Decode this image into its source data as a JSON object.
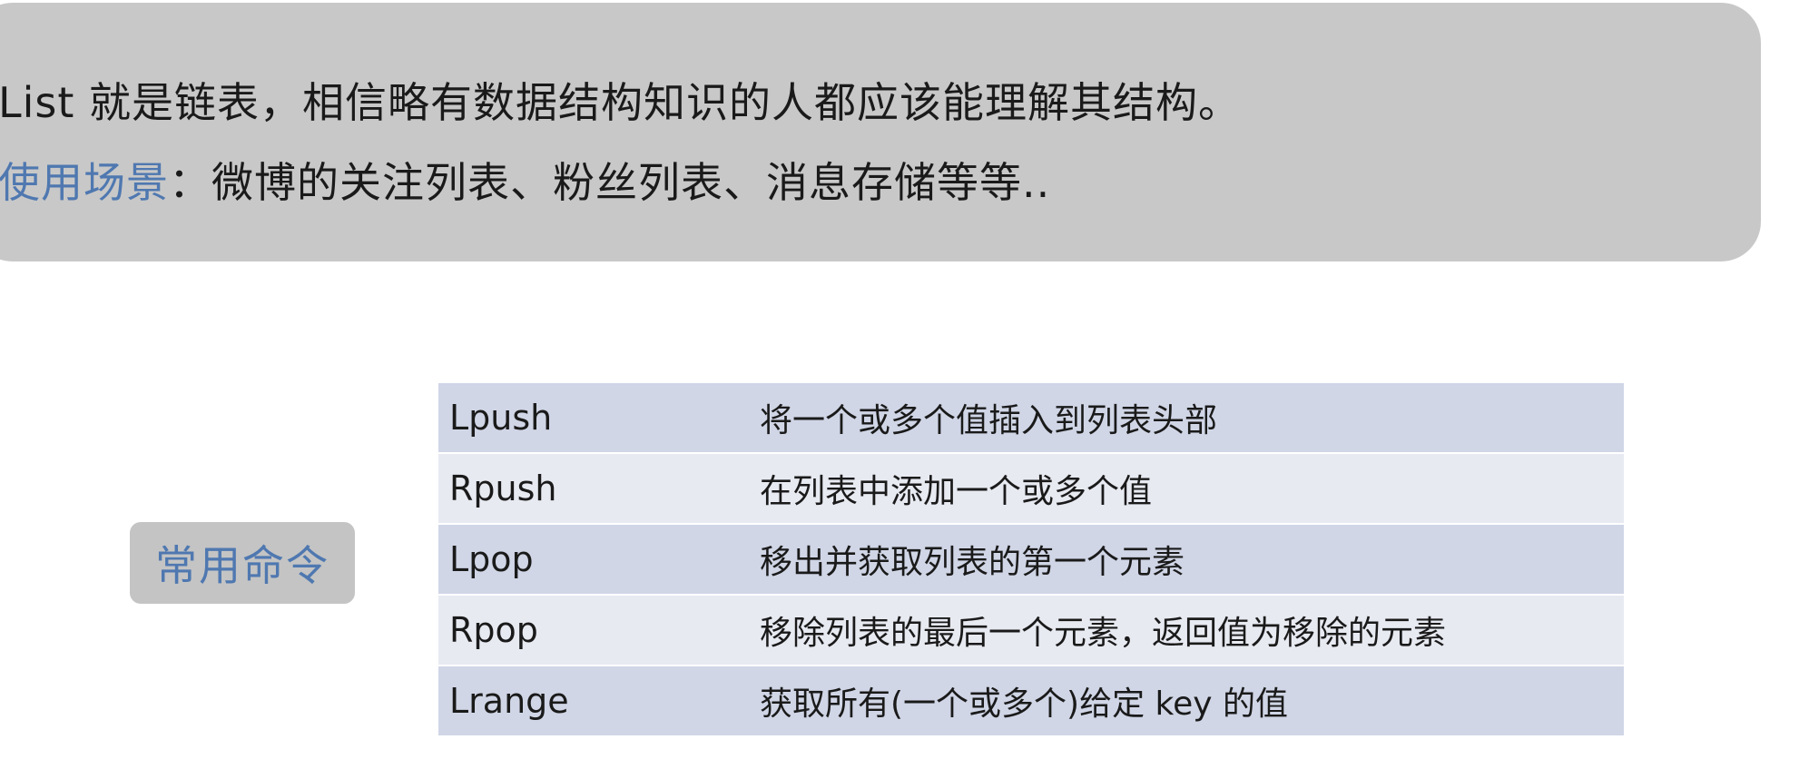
{
  "intro": {
    "line1": "List 就是链表，相信略有数据结构知识的人都应该能理解其结构。",
    "scenario_label": "使用场景",
    "scenario_sep": "：",
    "scenario_text": "微博的关注列表、粉丝列表、消息存储等等.."
  },
  "badge": {
    "label": "常用命令"
  },
  "colors": {
    "accent": "#4f78b0",
    "intro_bg": "#c8c8c8",
    "row_dark": "#d0d6e6",
    "row_light": "#e8eaf2"
  },
  "commands": [
    {
      "name": "Lpush",
      "desc": "将一个或多个值插入到列表头部"
    },
    {
      "name": "Rpush",
      "desc": "在列表中添加一个或多个值"
    },
    {
      "name": "Lpop",
      "desc": "移出并获取列表的第一个元素"
    },
    {
      "name": "Rpop",
      "desc": "移除列表的最后一个元素，返回值为移除的元素"
    },
    {
      "name": "Lrange",
      "desc": "获取所有(一个或多个)给定 key 的值"
    }
  ]
}
